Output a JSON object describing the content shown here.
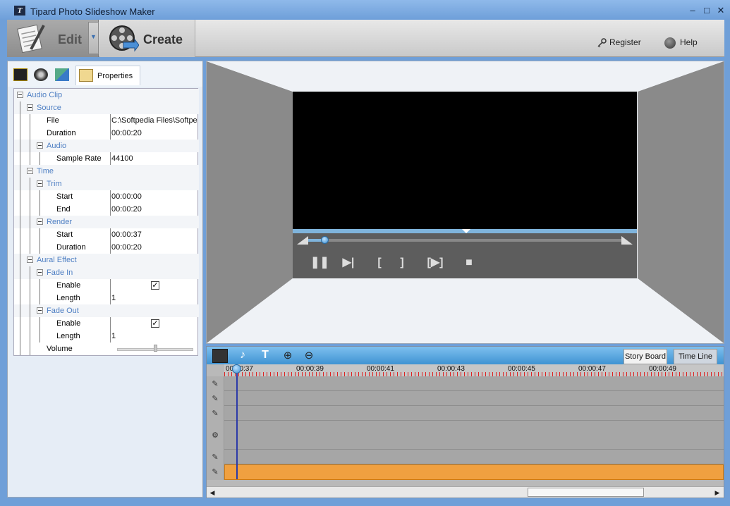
{
  "window": {
    "title": "Tipard Photo Slideshow Maker",
    "logo_letter": "T",
    "minimize": "–",
    "maximize": "□",
    "close": "✕"
  },
  "toolbar": {
    "edit_label": "Edit",
    "create_label": "Create",
    "register_label": "Register",
    "help_label": "Help",
    "dropdown_glyph": "▼"
  },
  "left_panel": {
    "properties_tab": "Properties",
    "rows": [
      {
        "label": "Audio Clip",
        "type": "group",
        "indent": 0
      },
      {
        "label": "Source",
        "type": "group",
        "indent": 1
      },
      {
        "label": "File",
        "type": "prop",
        "indent": 2,
        "value": "C:\\Softpedia Files\\Softpe"
      },
      {
        "label": "Duration",
        "type": "prop",
        "indent": 2,
        "value": "00:00:20"
      },
      {
        "label": "Audio",
        "type": "group",
        "indent": 2
      },
      {
        "label": "Sample Rate",
        "type": "prop",
        "indent": 3,
        "value": "44100"
      },
      {
        "label": "Time",
        "type": "group",
        "indent": 1
      },
      {
        "label": "Trim",
        "type": "group",
        "indent": 2
      },
      {
        "label": "Start",
        "type": "prop",
        "indent": 3,
        "value": "00:00:00"
      },
      {
        "label": "End",
        "type": "prop",
        "indent": 3,
        "value": "00:00:20"
      },
      {
        "label": "Render",
        "type": "group",
        "indent": 2
      },
      {
        "label": "Start",
        "type": "prop",
        "indent": 3,
        "value": "00:00:37"
      },
      {
        "label": "Duration",
        "type": "prop",
        "indent": 3,
        "value": "00:00:20"
      },
      {
        "label": "Aural Effect",
        "type": "group",
        "indent": 1
      },
      {
        "label": "Fade In",
        "type": "group",
        "indent": 2
      },
      {
        "label": "Enable",
        "type": "check",
        "indent": 3,
        "checked": true
      },
      {
        "label": "Length",
        "type": "prop",
        "indent": 3,
        "value": "1"
      },
      {
        "label": "Fade Out",
        "type": "group",
        "indent": 2
      },
      {
        "label": "Enable",
        "type": "check",
        "indent": 3,
        "checked": true
      },
      {
        "label": "Length",
        "type": "prop",
        "indent": 3,
        "value": "1"
      },
      {
        "label": "Volume",
        "type": "slider",
        "indent": 2
      }
    ]
  },
  "preview": {
    "progress_fraction": 0.06
  },
  "timeline": {
    "storyboard_label": "Story Board",
    "timeline_label": "Time Line",
    "ruler_labels": [
      "00:00:37",
      "00:00:39",
      "00:00:41",
      "00:00:43",
      "00:00:45",
      "00:00:47",
      "00:00:49"
    ],
    "left_arrow": "◀",
    "right_arrow": "▶"
  },
  "colors": {
    "accent_blue": "#3f93d2",
    "selected_track": "#f0a040",
    "ruler_ticks": "#d22222"
  }
}
